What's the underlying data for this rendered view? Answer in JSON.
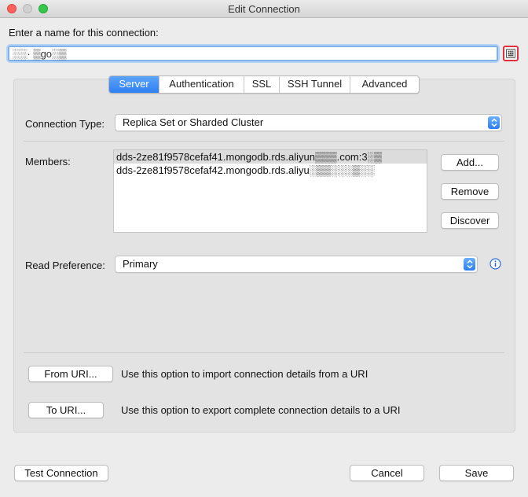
{
  "window": {
    "title": "Edit Connection"
  },
  "name_section": {
    "label": "Enter a name for this connection:",
    "value": "░░· ▒go░▒"
  },
  "tabs": [
    {
      "label": "Server",
      "active": true
    },
    {
      "label": "Authentication",
      "active": false
    },
    {
      "label": "SSL",
      "active": false
    },
    {
      "label": "SSH Tunnel",
      "active": false
    },
    {
      "label": "Advanced",
      "active": false
    }
  ],
  "server": {
    "connection_type_label": "Connection Type:",
    "connection_type_value": "Replica Set or Sharded Cluster",
    "members_label": "Members:",
    "members": [
      "dds-2ze81f9578cefaf41.mongodb.rds.aliyun▒▒▒.com:3░▒",
      "dds-2ze81f9578cefaf42.mongodb.rds.aliyu░▒▒░░░▒░░"
    ],
    "add_button": "Add...",
    "remove_button": "Remove",
    "discover_button": "Discover",
    "read_preference_label": "Read Preference:",
    "read_preference_value": "Primary"
  },
  "uri": {
    "from_button": "From URI...",
    "from_desc": "Use this option to import connection details from a URI",
    "to_button": "To URI...",
    "to_desc": "Use this option to export complete connection details to a URI"
  },
  "footer": {
    "test_button": "Test Connection",
    "cancel_button": "Cancel",
    "save_button": "Save"
  },
  "colors": {
    "accent": "#2e7ff1",
    "focus_ring": "#7fb1ea",
    "highlight_red": "#e0323e"
  },
  "icons": {
    "kbd_button": "keyboard-grid-icon",
    "info": "info-icon",
    "select_arrow": "updown-chevron-icon"
  }
}
